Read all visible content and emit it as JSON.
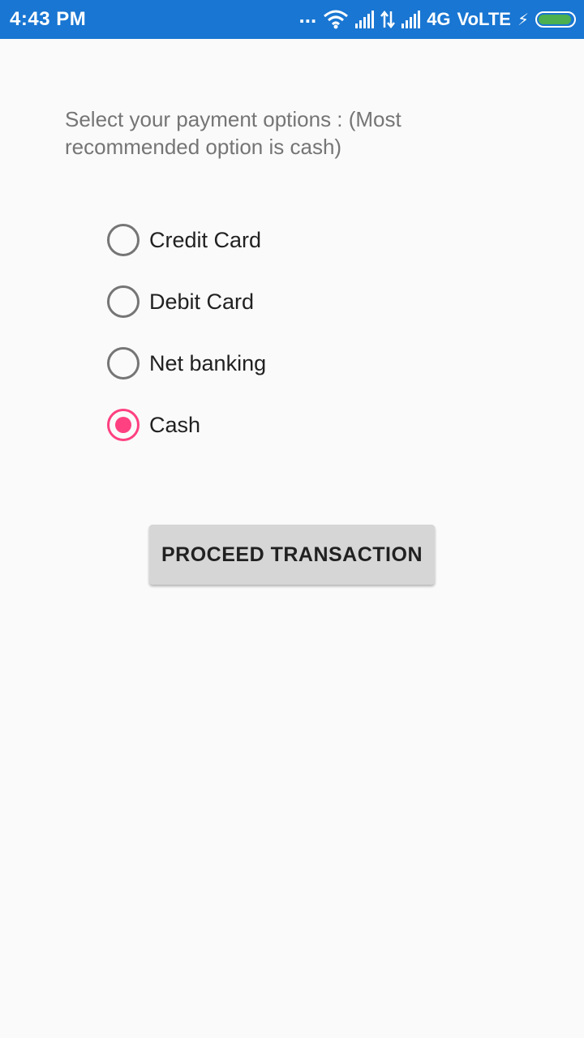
{
  "status_bar": {
    "time": "4:43 PM",
    "overflow": "...",
    "network": "4G",
    "volte": "VoLTE",
    "charging_symbol": "⚡",
    "icons": [
      "wifi-icon",
      "signal-icon",
      "data-arrows-icon",
      "signal-icon",
      "battery-icon"
    ],
    "background_color": "#1976d2"
  },
  "content": {
    "prompt": "Select your payment options : (Most recommended option is cash)",
    "options": [
      {
        "label": "Credit Card",
        "checked": false
      },
      {
        "label": "Debit Card",
        "checked": false
      },
      {
        "label": "Net banking",
        "checked": false
      },
      {
        "label": "Cash",
        "checked": true
      }
    ],
    "accent_color": "#ff4081",
    "proceed_button": "PROCEED TRANSACTION"
  }
}
